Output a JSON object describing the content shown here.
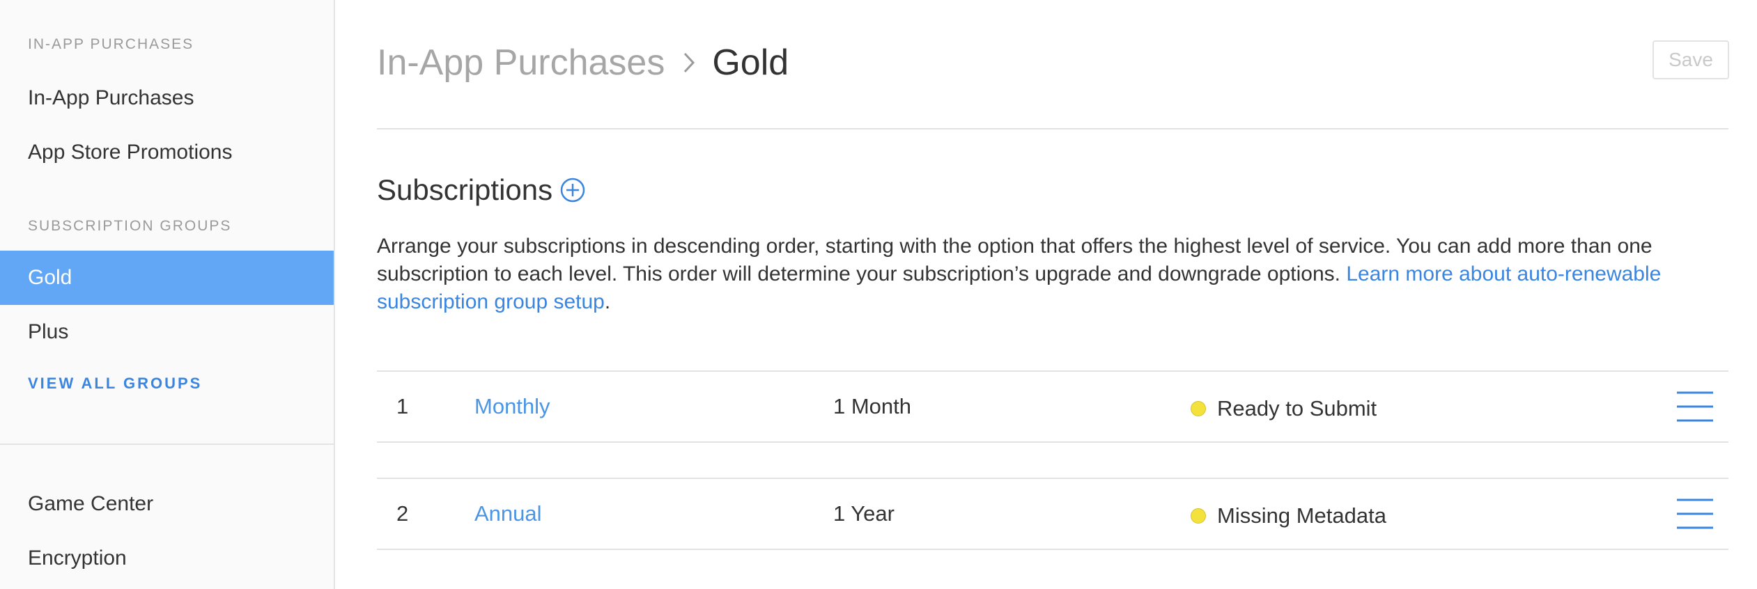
{
  "sidebar": {
    "section_in_app": "IN-APP PURCHASES",
    "items_in_app": [
      "In-App Purchases",
      "App Store Promotions"
    ],
    "section_groups": "SUBSCRIPTION GROUPS",
    "groups": [
      "Gold",
      "Plus"
    ],
    "active_group": "Gold",
    "view_all": "VIEW ALL GROUPS",
    "items_bottom": [
      "Game Center",
      "Encryption"
    ]
  },
  "header": {
    "breadcrumb_parent": "In-App Purchases",
    "breadcrumb_current": "Gold",
    "separator_icon": "chevron-right-icon",
    "save_label": "Save"
  },
  "subscriptions": {
    "title": "Subscriptions",
    "add_icon": "plus-circle-icon",
    "description": "Arrange your subscriptions in descending order, starting with the option that offers the highest level of service. You can add more than one subscription to each level. This order will determine your subscription’s upgrade and downgrade options.",
    "link_text": "Learn more about auto-renewable subscription group setup",
    "link_suffix": ".",
    "rows": [
      {
        "rank": "1",
        "name": "Monthly",
        "duration": "1 Month",
        "status": "Ready to Submit",
        "status_color": "#f4e23c"
      },
      {
        "rank": "2",
        "name": "Annual",
        "duration": "1 Year",
        "status": "Missing Metadata",
        "status_color": "#f4e23c"
      }
    ],
    "reorder_icon": "hamburger-icon"
  },
  "colors": {
    "accent": "#3a85e0",
    "active_bg": "#61a7f5",
    "status_pending": "#f4e23c"
  }
}
